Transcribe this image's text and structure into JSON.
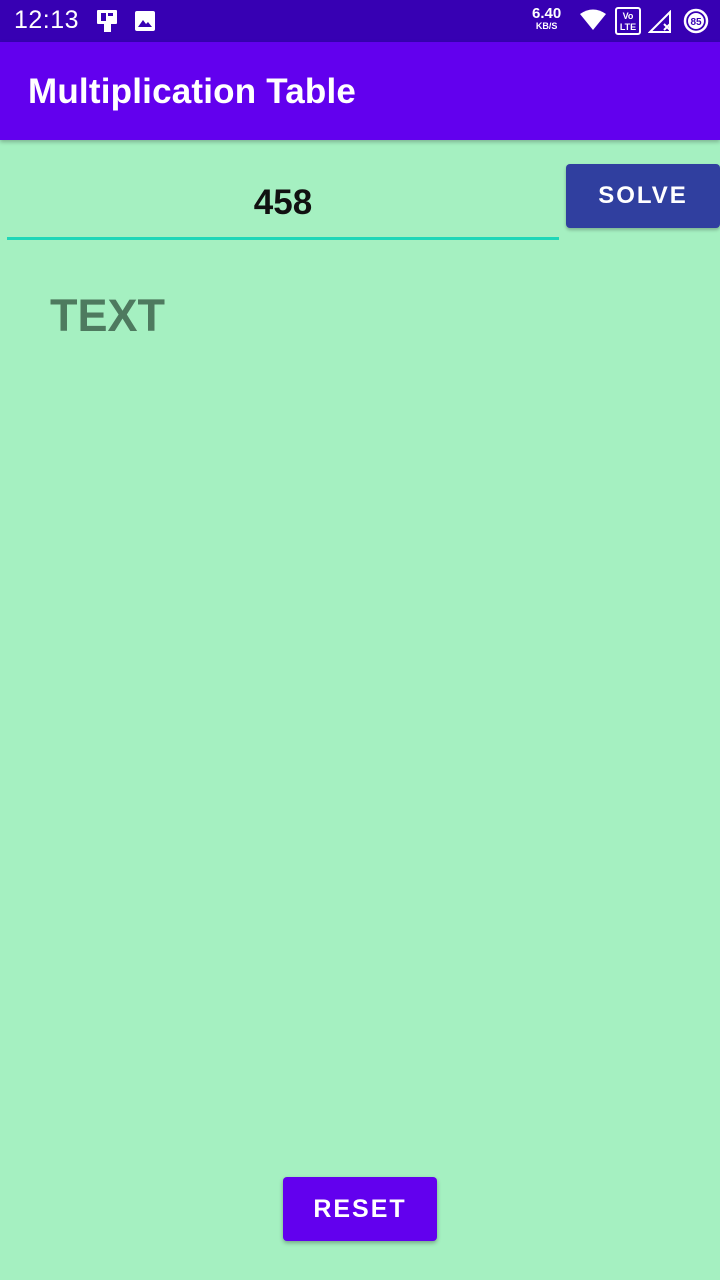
{
  "status_bar": {
    "time": "12:13",
    "speed_value": "6.40",
    "speed_unit": "KB/S",
    "volte_label_top": "Vo",
    "volte_label_bottom": "LTE",
    "battery_level": "85",
    "icons": [
      "sim-toolkit-icon",
      "image-icon",
      "wifi-icon",
      "volte-icon",
      "signal-icon",
      "battery-icon"
    ]
  },
  "app_bar": {
    "title": "Multiplication Table"
  },
  "form": {
    "number_value": "458",
    "solve_label": "SOLVE"
  },
  "result": {
    "text": "TEXT"
  },
  "footer": {
    "reset_label": "RESET"
  },
  "colors": {
    "background": "#a5f0c1",
    "status_bar": "#3700b3",
    "app_bar": "#6200ee",
    "solve_button": "#303f9f",
    "reset_button": "#6200ee",
    "input_underline": "#1fd6b8",
    "result_text": "#4e7a5f"
  }
}
